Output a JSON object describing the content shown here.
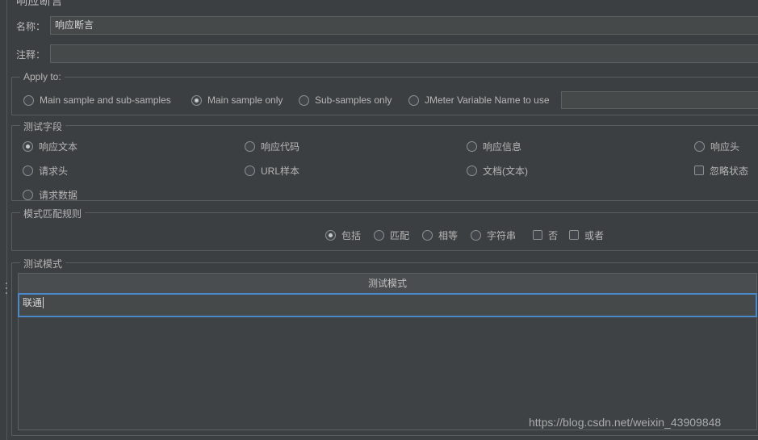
{
  "window": {
    "title": "响应断言"
  },
  "name_field": {
    "label": "名称：",
    "value": "响应断言"
  },
  "comment_field": {
    "label": "注释：",
    "value": "",
    "placeholder": ""
  },
  "apply_to": {
    "title": "Apply to:",
    "options": [
      {
        "label": "Main sample and sub-samples",
        "selected": false
      },
      {
        "label": "Main sample only",
        "selected": true
      },
      {
        "label": "Sub-samples only",
        "selected": false
      },
      {
        "label": "JMeter Variable Name to use",
        "selected": false
      }
    ],
    "variable_name_value": ""
  },
  "test_field": {
    "title": "测试字段",
    "options": [
      {
        "label": "响应文本",
        "type": "radio",
        "selected": true
      },
      {
        "label": "响应代码",
        "type": "radio",
        "selected": false
      },
      {
        "label": "响应信息",
        "type": "radio",
        "selected": false
      },
      {
        "label": "响应头",
        "type": "radio",
        "selected": false
      },
      {
        "label": "请求头",
        "type": "radio",
        "selected": false
      },
      {
        "label": "URL样本",
        "type": "radio",
        "selected": false
      },
      {
        "label": "文档(文本)",
        "type": "radio",
        "selected": false
      },
      {
        "label": "忽略状态",
        "type": "checkbox",
        "selected": false
      },
      {
        "label": "请求数据",
        "type": "radio",
        "selected": false
      }
    ]
  },
  "pattern_rules": {
    "title": "模式匹配规则",
    "options": [
      {
        "label": "包括",
        "type": "radio",
        "selected": true
      },
      {
        "label": "匹配",
        "type": "radio",
        "selected": false
      },
      {
        "label": "相等",
        "type": "radio",
        "selected": false
      },
      {
        "label": "字符串",
        "type": "radio",
        "selected": false
      },
      {
        "label": "否",
        "type": "checkbox",
        "selected": false
      },
      {
        "label": "或者",
        "type": "checkbox",
        "selected": false
      }
    ]
  },
  "test_patterns": {
    "title": "测试模式",
    "column_header": "测试模式",
    "editing_value": "联通"
  },
  "watermark": {
    "text": "https://blog.csdn.net/weixin_43909848"
  },
  "colors": {
    "background": "#3c3f41",
    "input_background": "#45494a",
    "border": "#5a5d5e",
    "text": "#bbbbbb",
    "focus_accent": "#4a88c7",
    "table_header": "#4a4d4f"
  }
}
